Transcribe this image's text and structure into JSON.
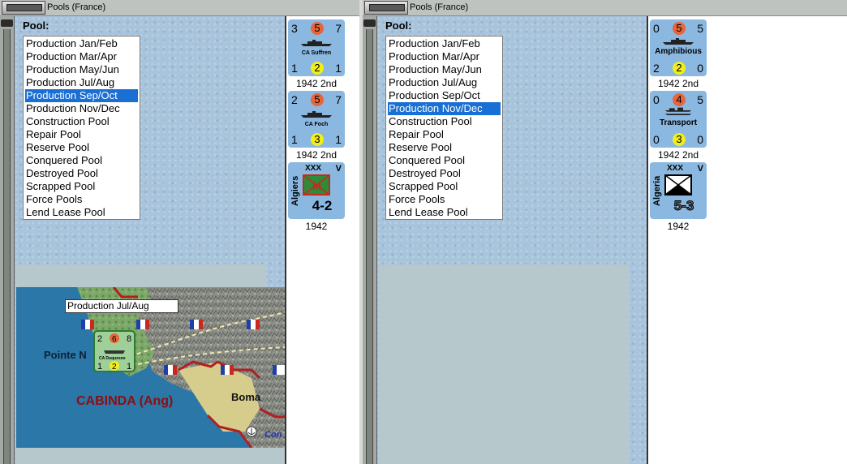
{
  "left_window": {
    "title": "Pools (France)",
    "pool_label": "Pool:",
    "pool_items": [
      {
        "label": "Production Jan/Feb",
        "selected": false
      },
      {
        "label": "Production Mar/Apr",
        "selected": false
      },
      {
        "label": "Production May/Jun",
        "selected": false
      },
      {
        "label": "Production Jul/Aug",
        "selected": false
      },
      {
        "label": "Production Sep/Oct",
        "selected": true
      },
      {
        "label": "Production Nov/Dec",
        "selected": false
      },
      {
        "label": "Construction Pool",
        "selected": false
      },
      {
        "label": "Repair Pool",
        "selected": false
      },
      {
        "label": "Reserve Pool",
        "selected": false
      },
      {
        "label": "Conquered Pool",
        "selected": false
      },
      {
        "label": "Destroyed Pool",
        "selected": false
      },
      {
        "label": "Scrapped Pool",
        "selected": false
      },
      {
        "label": "Force Pools",
        "selected": false
      },
      {
        "label": "Lend Lease Pool",
        "selected": false
      }
    ],
    "map": {
      "tooltip": "Production Jul/Aug",
      "labels": {
        "pointe": "Pointe N",
        "cabinda": "CABINDA (Ang)",
        "boma": "Boma",
        "con": "Con"
      },
      "drag_counter": {
        "tl": "2",
        "tm": "6",
        "tr": "8",
        "name": "CA Duquesne",
        "bl": "1",
        "bm": "2",
        "br": "1"
      }
    },
    "units": [
      {
        "kind": "ship",
        "tl": "3",
        "tm": "5",
        "tr": "7",
        "name": "CA Suffren",
        "bl": "1",
        "bm": "2",
        "br": "1",
        "caption": "1942 2nd"
      },
      {
        "kind": "ship",
        "tl": "2",
        "tm": "5",
        "tr": "7",
        "name": "CA Foch",
        "bl": "1",
        "bm": "3",
        "br": "1",
        "caption": "1942 2nd"
      },
      {
        "kind": "land",
        "region": "Algiers",
        "size": "XXX",
        "v": "V",
        "strength": "4-2",
        "caption": "1942"
      }
    ],
    "colors": {
      "selected": "#1a6fd4",
      "counter_bg": "#8ab8e0",
      "orange_disc": "#e8643a",
      "yellow_disc": "#f2ee1a",
      "inf_green": "#2e8b3a",
      "inf_red": "#c8281e"
    }
  },
  "right_window": {
    "title": "Pools (France)",
    "pool_label": "Pool:",
    "pool_items": [
      {
        "label": "Production Jan/Feb",
        "selected": false
      },
      {
        "label": "Production Mar/Apr",
        "selected": false
      },
      {
        "label": "Production May/Jun",
        "selected": false
      },
      {
        "label": "Production Jul/Aug",
        "selected": false
      },
      {
        "label": "Production Sep/Oct",
        "selected": false
      },
      {
        "label": "Production Nov/Dec",
        "selected": true
      },
      {
        "label": "Construction Pool",
        "selected": false
      },
      {
        "label": "Repair Pool",
        "selected": false
      },
      {
        "label": "Reserve Pool",
        "selected": false
      },
      {
        "label": "Conquered Pool",
        "selected": false
      },
      {
        "label": "Destroyed Pool",
        "selected": false
      },
      {
        "label": "Scrapped Pool",
        "selected": false
      },
      {
        "label": "Force Pools",
        "selected": false
      },
      {
        "label": "Lend Lease Pool",
        "selected": false
      }
    ],
    "units": [
      {
        "kind": "ship",
        "tl": "0",
        "tm": "5",
        "tr": "5",
        "name": "Amphibious",
        "bl": "2",
        "bm": "2",
        "br": "0",
        "caption": "1942 2nd"
      },
      {
        "kind": "ship",
        "tl": "0",
        "tm": "4",
        "tr": "5",
        "name": "Transport",
        "bl": "0",
        "bm": "3",
        "br": "0",
        "caption": "1942 2nd"
      },
      {
        "kind": "land",
        "region": "Algeria",
        "size": "XXX",
        "v": "V",
        "strength": "5-3",
        "caption": "1942"
      }
    ]
  }
}
